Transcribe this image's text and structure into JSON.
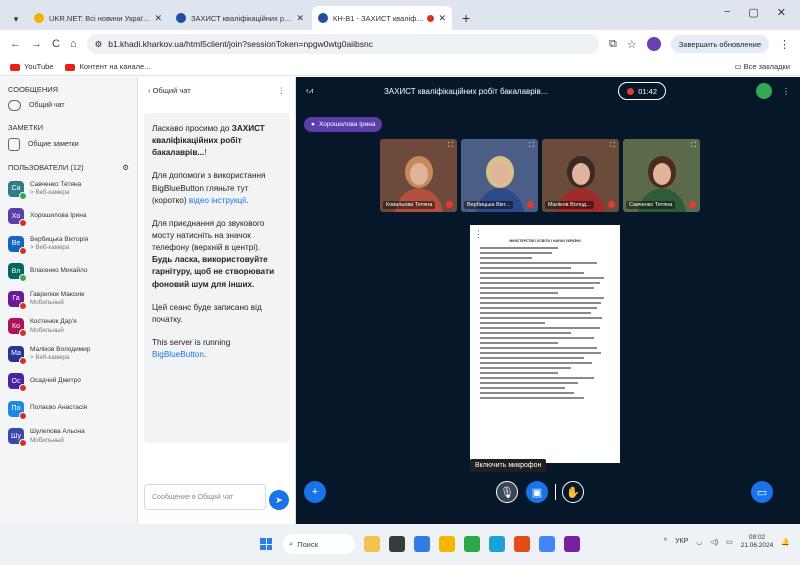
{
  "browser": {
    "tabs": [
      {
        "title": "UKR.NET: Всі новини України...",
        "active": false
      },
      {
        "title": "ЗАХИСТ кваліфікаційних робіт",
        "active": false
      },
      {
        "title": "КН-В1 - ЗАХИСТ кваліфіка",
        "active": true
      }
    ],
    "new_tab": "+",
    "window_controls": [
      "−",
      "▢",
      "✕"
    ],
    "url": "b1.khadi.kharkov.ua/html5client/join?sessionToken=npgw0wtg0aiibsnc",
    "update_button": "Завершить обновление",
    "bookmarks": [
      "YouTube",
      "Контент на канале..."
    ],
    "all_bookmarks": "Все закладки"
  },
  "sidebar": {
    "messages_header": "СООБЩЕНИЯ",
    "public_chat": "Общий чат",
    "notes_header": "ЗАМЕТКИ",
    "shared_notes": "Общие заметки",
    "users_header": "ПОЛЬЗОВАТЕЛИ (12)",
    "users": [
      {
        "initials": "Са",
        "name": "Савченко Тетяна",
        "sub": "> Веб-камера",
        "color": "#2e7d87",
        "badge": "webcam"
      },
      {
        "initials": "Хо",
        "name": "Хорошилова Ірина",
        "sub": "",
        "color": "#5b3ea8",
        "badge": "mute"
      },
      {
        "initials": "Ве",
        "name": "Вербицька Вікторія",
        "sub": "> Веб-камера",
        "color": "#1565c0",
        "badge": "mute"
      },
      {
        "initials": "Вл",
        "name": "Власенко Михайло",
        "sub": "",
        "color": "#00695c",
        "badge": "webcam"
      },
      {
        "initials": "Га",
        "name": "Гаврилюк Максим",
        "sub": "Мобильный",
        "color": "#6a1b9a",
        "badge": "mute"
      },
      {
        "initials": "Ко",
        "name": "Костенюк Дар'я",
        "sub": "Мобильный",
        "color": "#ad1457",
        "badge": "mute"
      },
      {
        "initials": "Ма",
        "name": "Маліков Володимир",
        "sub": "> Веб-камера",
        "color": "#283593",
        "badge": "mute"
      },
      {
        "initials": "Ос",
        "name": "Осадчий Дмитро",
        "sub": "",
        "color": "#4527a0",
        "badge": "mute"
      },
      {
        "initials": "По",
        "name": "Полаєво Анастасія",
        "sub": "",
        "color": "#1e88e5",
        "badge": "mute"
      },
      {
        "initials": "Шу",
        "name": "Шулепова Альона",
        "sub": "Мобильный",
        "color": "#3949ab",
        "badge": "mute"
      }
    ]
  },
  "chat": {
    "title": "Общий чат",
    "back": "‹",
    "menu": "⋮",
    "welcome_pre": "Ласкаво просимо до ",
    "welcome_bold": "ЗАХИСТ кваліфікаційних робіт бакалаврів...",
    "welcome_post": "!",
    "help_pre": "Для допомоги з використання BigBlueButton гляньте тут (коротко) ",
    "help_link": "відео інструкції",
    "help_post": ".",
    "phone_pre": "Для приєднання до звукового мосту натисніть на значок телефону (верхній в центрі). ",
    "phone_bold": "Будь ласка, використовуйте гарнітуру, щоб не створювати фоновий шум для інших.",
    "recorded": "Цей сеанс буде записано від початку.",
    "running_pre": "This server is running ",
    "running_link": "BigBlueButton",
    "running_post": ".",
    "input_placeholder": "Сообщение в Общий чат",
    "send_icon": "➤"
  },
  "main": {
    "title": "ЗАХИСТ кваліфікаційних робіт бакалаврів...",
    "timer": "01:42",
    "talking": "Хорошилова Ірина",
    "cams": [
      {
        "name": "Ковальова Тетяна",
        "bg": "#6e4a3c",
        "shirt": "#b3503d",
        "hair": "#c58b5a"
      },
      {
        "name": "Вербицька Вікт...",
        "bg": "#4b5f86",
        "shirt": "#2c4a8a",
        "hair": "#d9c08a"
      },
      {
        "name": "Маліков Волод...",
        "bg": "#6b4b3a",
        "shirt": "#a12a2a",
        "hair": "#3b2a22"
      },
      {
        "name": "Савченко Тетяна",
        "bg": "#5b6b4a",
        "shirt": "#2f5b3a",
        "hair": "#4a2c1d"
      }
    ],
    "doc_heading": "МІНІСТЕРСТВО ОСВІТИ І НАУКИ УКРАЇНИ",
    "mic_tooltip": "Включить микрофон"
  },
  "taskbar": {
    "search": "Поиск",
    "lang": "УКР",
    "time": "09:02",
    "date": "21.06.2024"
  }
}
